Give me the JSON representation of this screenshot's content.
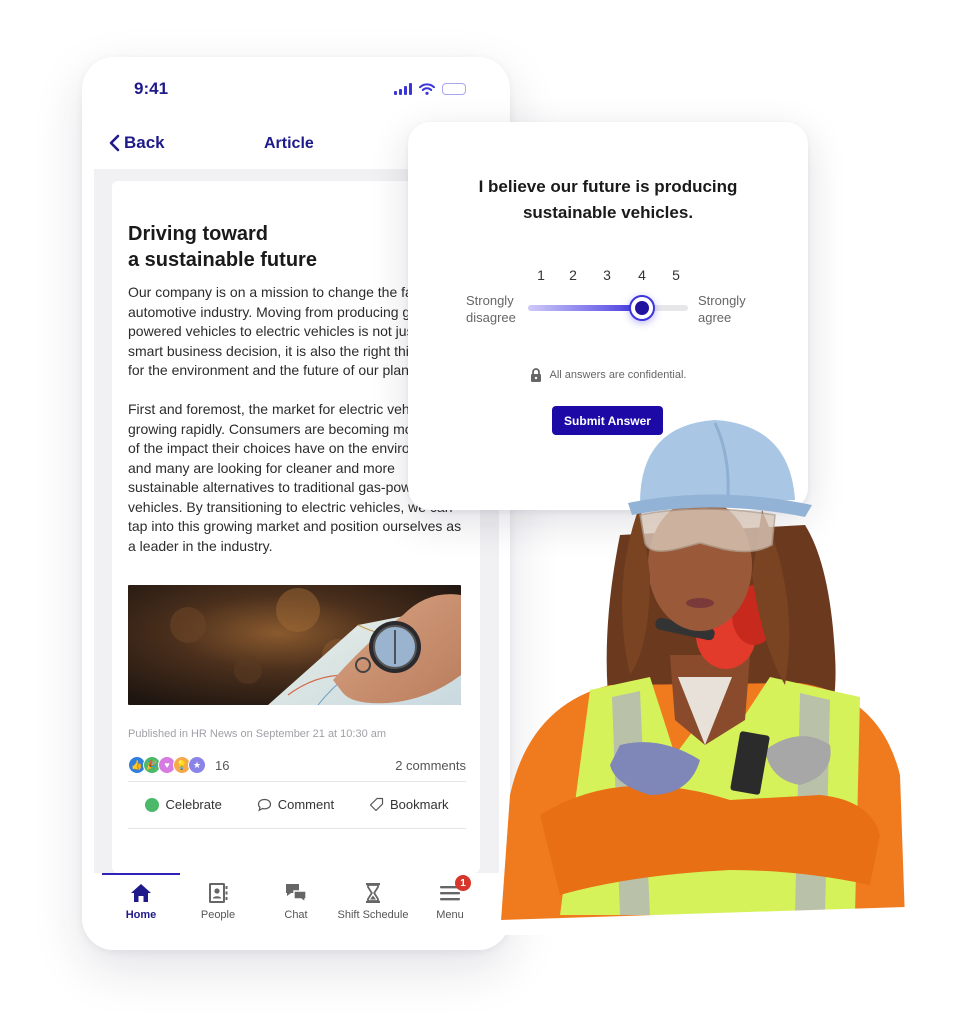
{
  "phone": {
    "status_bar": {
      "time": "9:41",
      "icons": [
        "signal-icon",
        "wifi-icon",
        "battery-icon"
      ]
    },
    "nav": {
      "back_label": "Back",
      "title": "Article"
    },
    "article": {
      "title_line1": "Driving toward",
      "title_line2": "a sustainable future",
      "paragraphs": [
        "Our company is on a mission to change the face of the automotive industry. Moving from producing gas-powered vehicles to electric vehicles is not just a smart business decision, it is also the right thing to do for the environment and the future of our planet.",
        "First and foremost, the market for electric vehicles is growing rapidly. Consumers are becoming more aware of the impact their choices have on the environment, and many are looking for cleaner and more sustainable alternatives to traditional gas-powered vehicles. By transitioning to electric vehicles, we can tap into this growing market and position ourselves as a leader in the industry."
      ],
      "image_alt": "Hand holding a compass over a map",
      "published": "Published in HR News on September 21 at 10:30 am",
      "reactions": {
        "icons": [
          {
            "name": "like",
            "color": "#2f7fe0"
          },
          {
            "name": "celebrate",
            "color": "#4cb86a"
          },
          {
            "name": "love",
            "color": "#d67be0"
          },
          {
            "name": "insightful",
            "color": "#f5a94a"
          },
          {
            "name": "support",
            "color": "#8b84e8"
          }
        ],
        "count": "16"
      },
      "comments": "2 comments",
      "actions": {
        "celebrate": "Celebrate",
        "comment": "Comment",
        "bookmark": "Bookmark"
      }
    },
    "tabs": [
      {
        "label": "Home",
        "icon": "home-icon",
        "active": true
      },
      {
        "label": "People",
        "icon": "contacts-icon",
        "active": false
      },
      {
        "label": "Chat",
        "icon": "chat-icon",
        "active": false
      },
      {
        "label": "Shift Schedule",
        "icon": "hourglass-icon",
        "active": false
      },
      {
        "label": "Menu",
        "icon": "menu-icon",
        "active": false,
        "badge": "1"
      }
    ]
  },
  "survey": {
    "question_line1": "I believe our future is producing",
    "question_line2": "sustainable vehicles.",
    "scale": [
      "1",
      "2",
      "3",
      "4",
      "5"
    ],
    "min_label_line1": "Strongly",
    "min_label_line2": "disagree",
    "max_label_line1": "Strongly",
    "max_label_line2": "agree",
    "selected_value": 4,
    "confidential_note": "All answers are confidential.",
    "submit_label": "Submit Answer"
  },
  "colors": {
    "brand_navy": "#1e1a8a",
    "button": "#1d0aa6",
    "slider_accent": "#3d34df",
    "badge": "#d7362b"
  },
  "photo": {
    "alt": "Construction worker in hard hat, safety glasses, orange coveralls and hi-vis vest with arms crossed"
  }
}
